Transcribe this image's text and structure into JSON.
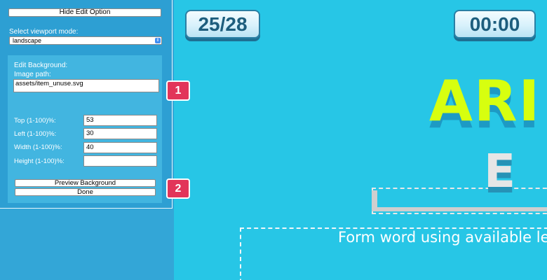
{
  "sidebar": {
    "hide_button": "Hide Edit Option",
    "viewport_label": "Select viewport mode:",
    "viewport_value": "landscape",
    "select_arrow_glyph": "⇕",
    "background_panel": {
      "title": "Edit Background:",
      "path_label": "Image path:",
      "path_value": "assets/item_unuse.svg",
      "fields": [
        {
          "label": "Top (1-100)%:",
          "value": "53"
        },
        {
          "label": "Left (1-100)%:",
          "value": "30"
        },
        {
          "label": "Width (1-100)%:",
          "value": "40"
        },
        {
          "label": "Height (1-100)%:",
          "value": ""
        }
      ],
      "preview_button": "Preview Background",
      "done_button": "Done"
    }
  },
  "callouts": [
    "1",
    "2"
  ],
  "game": {
    "progress": "25/28",
    "timer": "00:00",
    "title_fragment": "ARI",
    "tile_letter": "E",
    "instruction": "Form word using available le"
  },
  "colors": {
    "background": "#27c6e6",
    "sidebar": "#2d9fd3",
    "badge": "#e23559",
    "title": "#d7ff0f",
    "hud_text": "#1d5d7d"
  }
}
